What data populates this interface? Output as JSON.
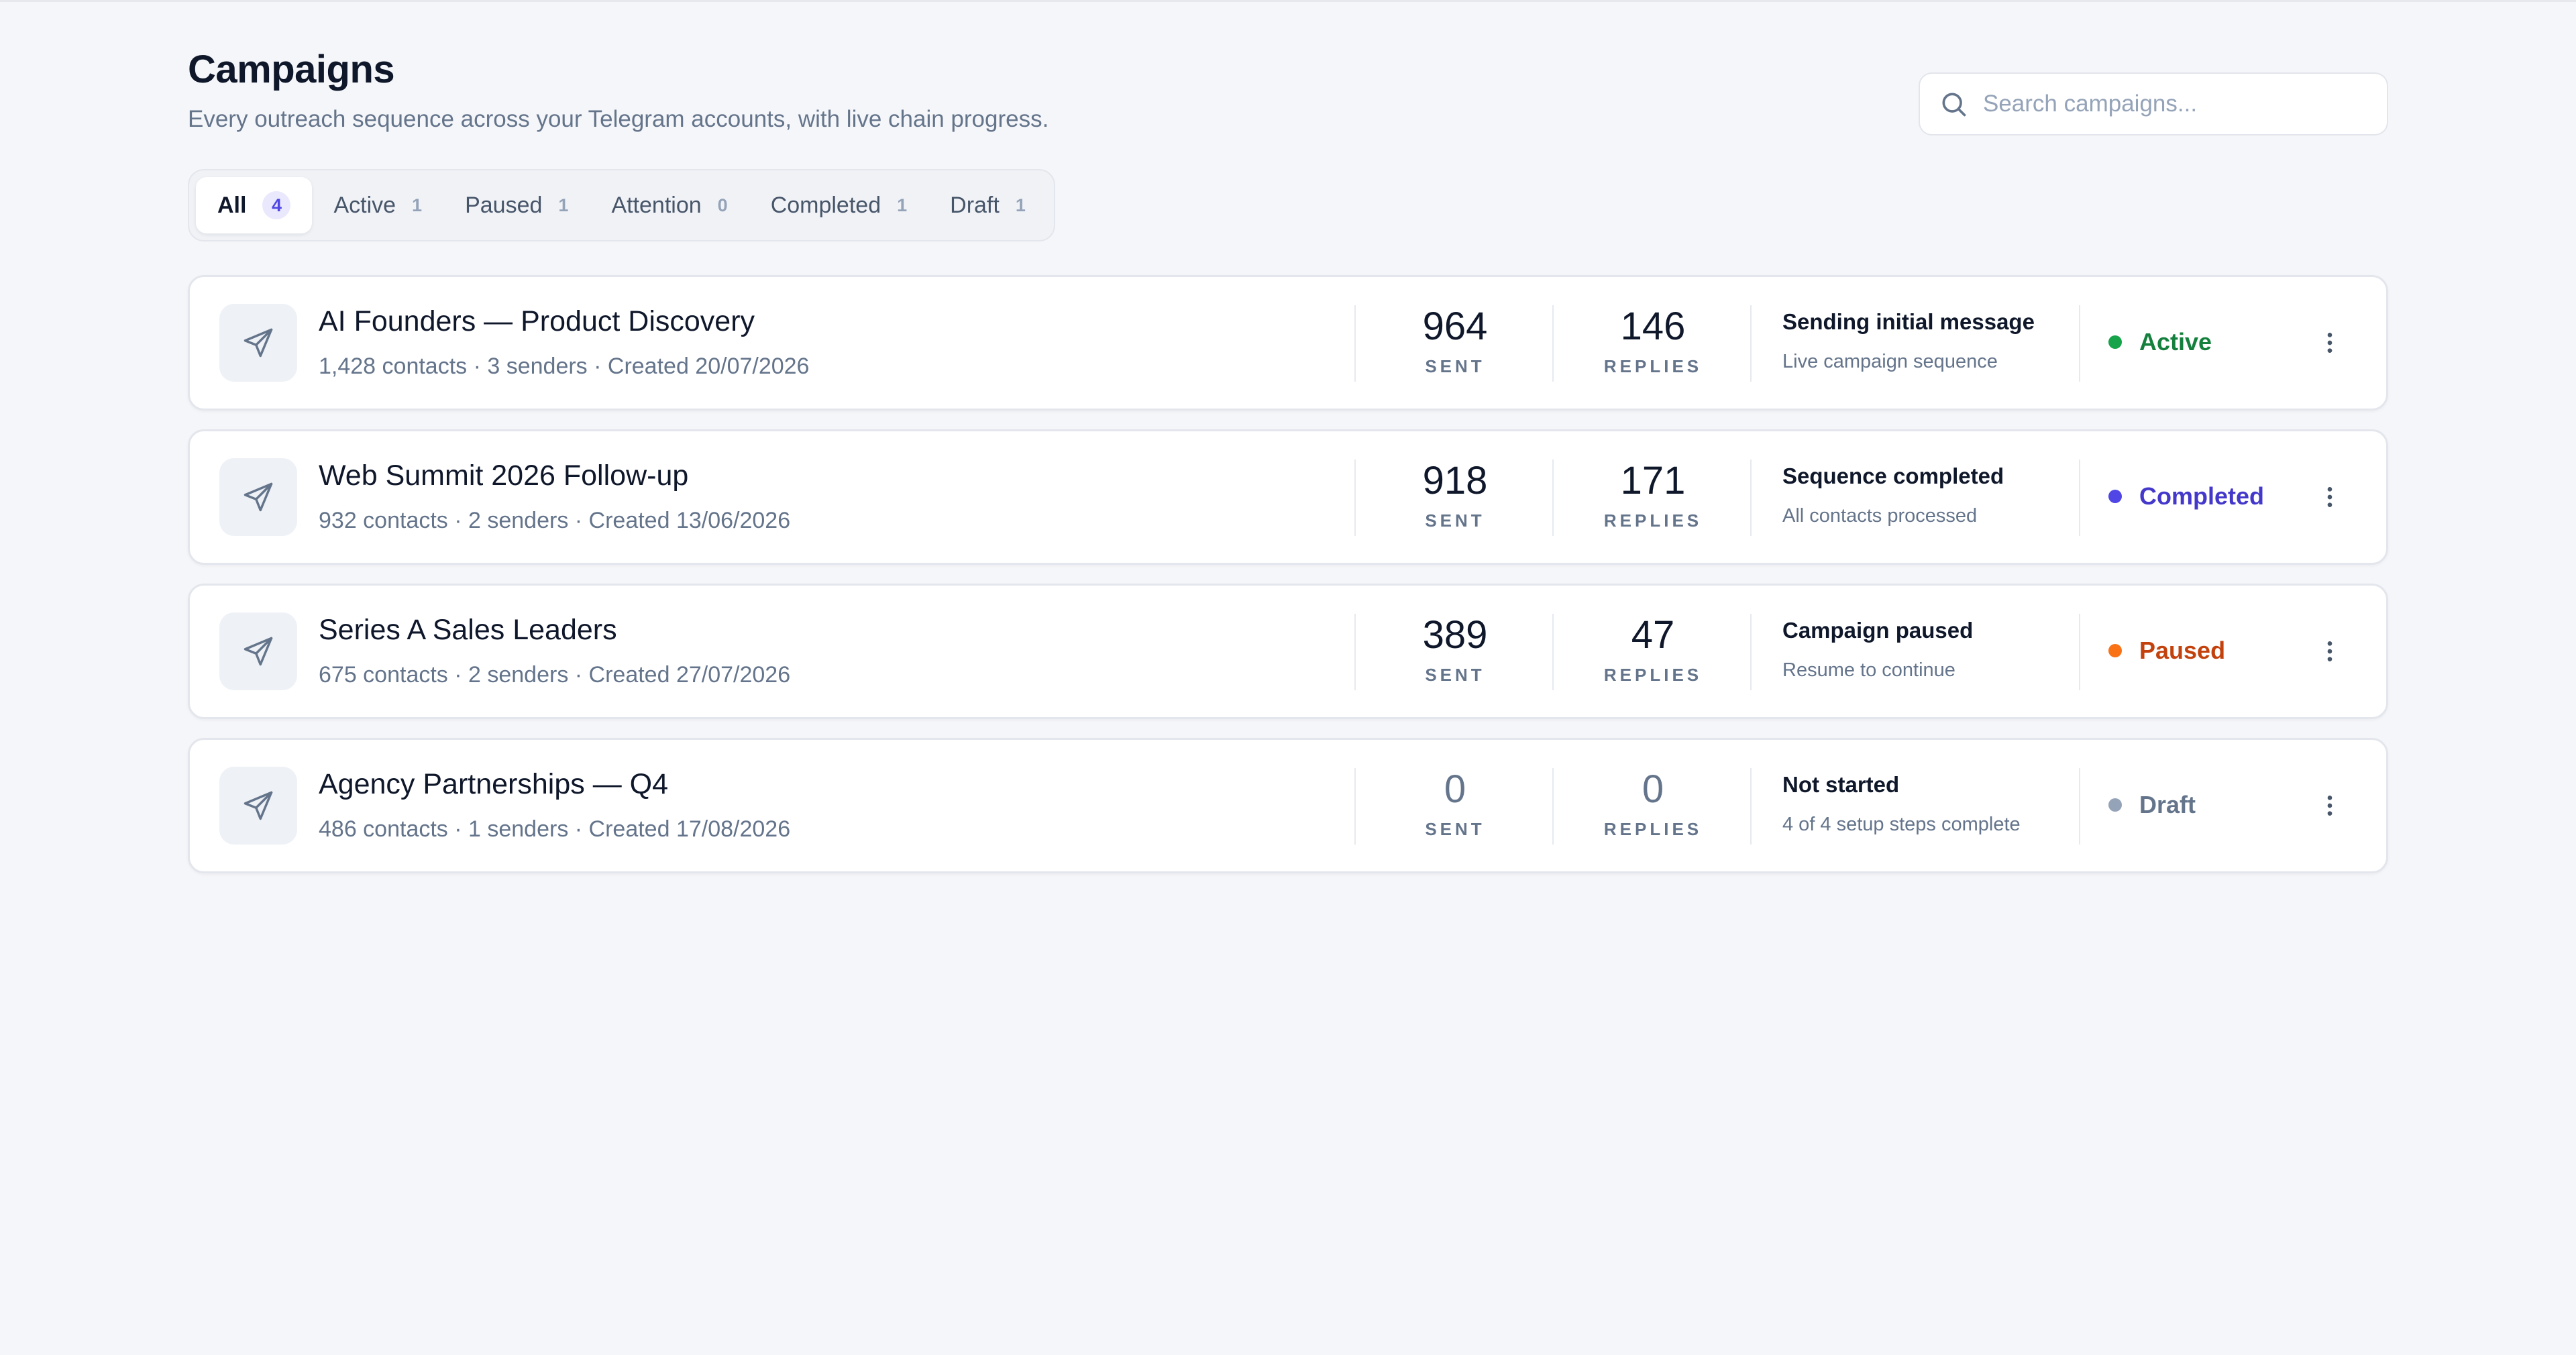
{
  "header": {
    "title": "Campaigns",
    "subtitle": "Every outreach sequence across your Telegram accounts, with live chain progress."
  },
  "search": {
    "placeholder": "Search campaigns...",
    "value": "",
    "icon": "search-icon"
  },
  "tabs": [
    {
      "label": "All",
      "count": "4",
      "selected": true
    },
    {
      "label": "Active",
      "count": "1"
    },
    {
      "label": "Paused",
      "count": "1"
    },
    {
      "label": "Attention",
      "count": "0"
    },
    {
      "label": "Completed",
      "count": "1"
    },
    {
      "label": "Draft",
      "count": "1"
    }
  ],
  "metric_labels": {
    "sent": "SENT",
    "replies": "REPLIES"
  },
  "campaigns": [
    {
      "name": "AI Founders — Product Discovery",
      "meta": "1,428 contacts · 3 senders · Created 20/07/2026",
      "sent": "964",
      "replies": "146",
      "progress_title": "Sending initial message",
      "progress_sub": "Live campaign sequence",
      "status": "Active",
      "status_color": "#15803d",
      "dot_color": "#16a34a"
    },
    {
      "name": "Web Summit 2026 Follow-up",
      "meta": "932 contacts · 2 senders · Created 13/06/2026",
      "sent": "918",
      "replies": "171",
      "progress_title": "Sequence completed",
      "progress_sub": "All contacts processed",
      "status": "Completed",
      "status_color": "#4338ca",
      "dot_color": "#4f46e5"
    },
    {
      "name": "Series A Sales Leaders",
      "meta": "675 contacts · 2 senders · Created 27/07/2026",
      "sent": "389",
      "replies": "47",
      "progress_title": "Campaign paused",
      "progress_sub": "Resume to continue",
      "status": "Paused",
      "status_color": "#c2410c",
      "dot_color": "#f97316"
    },
    {
      "name": "Agency Partnerships — Q4",
      "meta": "486 contacts · 1 senders · Created 17/08/2026",
      "sent": "0",
      "replies": "0",
      "progress_title": "Not started",
      "progress_sub": "4 of 4 setup steps complete",
      "status": "Draft",
      "status_color": "#64748b",
      "dot_color": "#94a3b8"
    }
  ],
  "icons": {
    "campaign": "send-icon",
    "menu": "more-vertical-icon"
  }
}
